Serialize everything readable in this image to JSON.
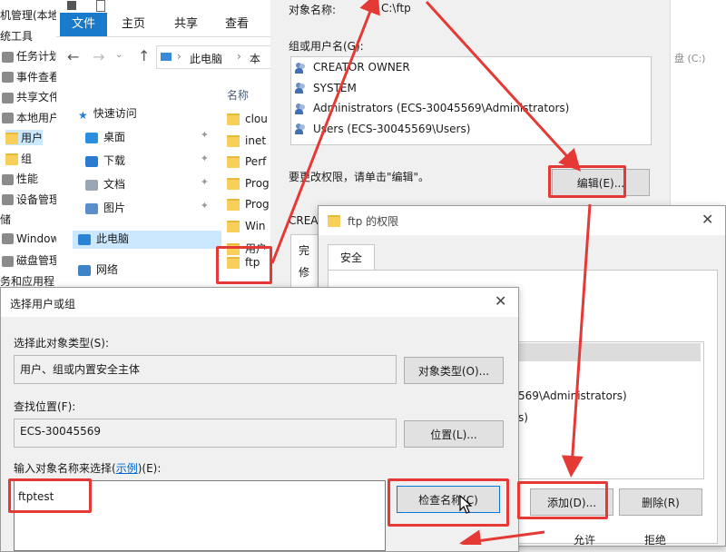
{
  "mmc": {
    "items": [
      {
        "label": "机管理(本地",
        "icon": "computer-icon"
      },
      {
        "label": "统工具",
        "icon": "tools-icon"
      },
      {
        "label": "任务计划",
        "icon": "clock-icon"
      },
      {
        "label": "事件查看",
        "icon": "event-icon"
      },
      {
        "label": "共享文件",
        "icon": "share-icon"
      },
      {
        "label": "本地用户",
        "icon": "users-icon"
      },
      {
        "label": "用户",
        "icon": "folder-icon"
      },
      {
        "label": "组",
        "icon": "folder-icon"
      },
      {
        "label": "性能",
        "icon": "performance-icon"
      },
      {
        "label": "设备管理",
        "icon": "device-icon"
      },
      {
        "label": "储",
        "icon": "storage-icon"
      },
      {
        "label": "Window",
        "icon": "windows-icon"
      },
      {
        "label": "磁盘管理",
        "icon": "disk-icon"
      },
      {
        "label": "务和应用程",
        "icon": "service-icon"
      }
    ]
  },
  "explorer": {
    "ribbon_tabs": [
      "文件",
      "主页",
      "共享",
      "查看"
    ],
    "path": [
      "此电脑",
      "本"
    ],
    "column_name": "名称",
    "nav": [
      {
        "label": "快速访问",
        "icon": "star-icon",
        "pinned": false
      },
      {
        "label": "桌面",
        "icon": "desktop-icon",
        "pinned": true
      },
      {
        "label": "下载",
        "icon": "download-icon",
        "pinned": true
      },
      {
        "label": "文档",
        "icon": "document-icon",
        "pinned": true
      },
      {
        "label": "图片",
        "icon": "picture-icon",
        "pinned": true
      },
      {
        "label": "此电脑",
        "icon": "pc-icon",
        "pinned": false
      },
      {
        "label": "网络",
        "icon": "network-icon",
        "pinned": false
      }
    ],
    "files": [
      "clou",
      "inet",
      "Perf",
      "Prog",
      "Prog",
      "Win",
      "用户",
      "ftp"
    ],
    "search_hint": "盘 (C:)"
  },
  "props": {
    "object_label": "对象名称:",
    "object_value": "C:\\ftp",
    "group_label": "组或用户名(G):",
    "users": [
      "CREATOR OWNER",
      "SYSTEM",
      "Administrators (ECS-30045569\\Administrators)",
      "Users (ECS-30045569\\Users)"
    ],
    "change_text": "要更改权限，请单击\"编辑\"。",
    "edit_button": "编辑(E)...",
    "partial_label": "CREA",
    "partial_1": "完",
    "partial_2": "修"
  },
  "perm": {
    "title": "ftp 的权限",
    "tab": "安全",
    "partial_1": "569\\Administrators)",
    "partial_2": "s)",
    "add_button": "添加(D)...",
    "remove_button": "删除(R)",
    "col_allow": "允许",
    "col_deny": "拒绝"
  },
  "select": {
    "title": "选择用户或组",
    "type_label": "选择此对象类型(S):",
    "type_value": "用户、组或内置安全主体",
    "type_button": "对象类型(O)...",
    "loc_label": "查找位置(F):",
    "loc_value": "ECS-30045569",
    "loc_button": "位置(L)...",
    "name_label_pre": "输入对象名称来选择(",
    "name_label_link": "示例",
    "name_label_post": ")(E):",
    "name_value": "ftptest",
    "check_button": "检查名称(C)"
  },
  "colors": {
    "annotation": "#e53935",
    "ribbon_file": "#1979ca"
  }
}
